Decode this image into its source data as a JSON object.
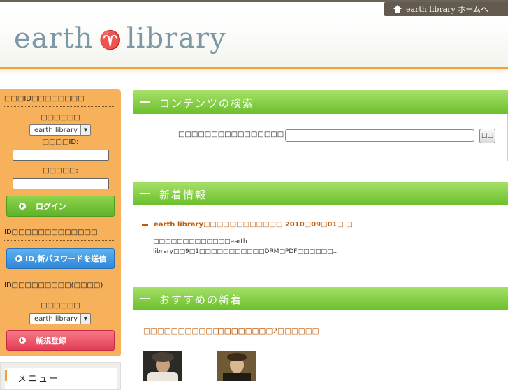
{
  "header": {
    "home_link": "earth library ホームへ",
    "logo_left": "earth",
    "logo_right": "library",
    "colors": {
      "accent_orange": "#f1a040",
      "brand_blue": "#7c98a6",
      "green": "#6bbf2c"
    }
  },
  "sidebar": {
    "login_title": "□□□ID□□□□□□□□",
    "library_label": "□□□□□□",
    "library_select": "earth library",
    "id_label": "□□□□ID:",
    "password_label": "□□□□□:",
    "login_button": "ログイン",
    "forgot_text": "ID□□□□□□□□□□□□□",
    "send_button": "ID,新パスワードを送信",
    "register_text": "ID□□□□□□□□□(□□□□)",
    "library_label2": "□□□□□□",
    "library_select2": "earth library",
    "register_button": "新規登録",
    "menu_label": "メニュー"
  },
  "main": {
    "search_title": "コンテンツの検索",
    "search_label": "□□□□□□□□□□□□□□□□",
    "search_button": "□□",
    "news_title": "新着情報",
    "news_item_title": "earth library□□□□□□□□□□□□ 2010□09□01□ □",
    "news_item_body": "□□□□□□□□□□□□□earth library□□9□1□□□□□□□□□□□DRM□PDF□□□□□□...",
    "rec_title": "おすすめの新着",
    "rec_items": [
      {
        "title": "□□□□□□□□□□□1□□□□□□",
        "icon": "beethoven-portrait"
      },
      {
        "title": "□□□□□□□□2□□□□□□",
        "icon": "chopin-portrait"
      }
    ]
  }
}
